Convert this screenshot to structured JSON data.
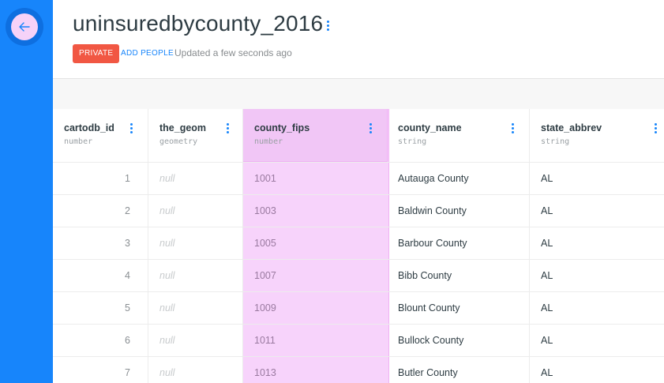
{
  "sidebar": {
    "back_icon": "arrow-left-icon"
  },
  "header": {
    "title": "uninsuredbycounty_2016",
    "privacy": "PRIVATE",
    "add_people": "ADD PEOPLE",
    "updated": "Updated a few seconds ago"
  },
  "colors": {
    "accent": "#1785fb",
    "private_badge": "#f15743",
    "highlight": "#f7d3fb"
  },
  "table": {
    "columns": [
      {
        "name": "cartodb_id",
        "type": "number"
      },
      {
        "name": "the_geom",
        "type": "geometry"
      },
      {
        "name": "county_fips",
        "type": "number"
      },
      {
        "name": "county_name",
        "type": "string"
      },
      {
        "name": "state_abbrev",
        "type": "string"
      }
    ],
    "rows": [
      {
        "id": "1",
        "geom": "null",
        "fips": "1001",
        "county": "Autauga County",
        "state": "AL"
      },
      {
        "id": "2",
        "geom": "null",
        "fips": "1003",
        "county": "Baldwin County",
        "state": "AL"
      },
      {
        "id": "3",
        "geom": "null",
        "fips": "1005",
        "county": "Barbour County",
        "state": "AL"
      },
      {
        "id": "4",
        "geom": "null",
        "fips": "1007",
        "county": "Bibb County",
        "state": "AL"
      },
      {
        "id": "5",
        "geom": "null",
        "fips": "1009",
        "county": "Blount County",
        "state": "AL"
      },
      {
        "id": "6",
        "geom": "null",
        "fips": "1011",
        "county": "Bullock County",
        "state": "AL"
      },
      {
        "id": "7",
        "geom": "null",
        "fips": "1013",
        "county": "Butler County",
        "state": "AL"
      }
    ]
  }
}
